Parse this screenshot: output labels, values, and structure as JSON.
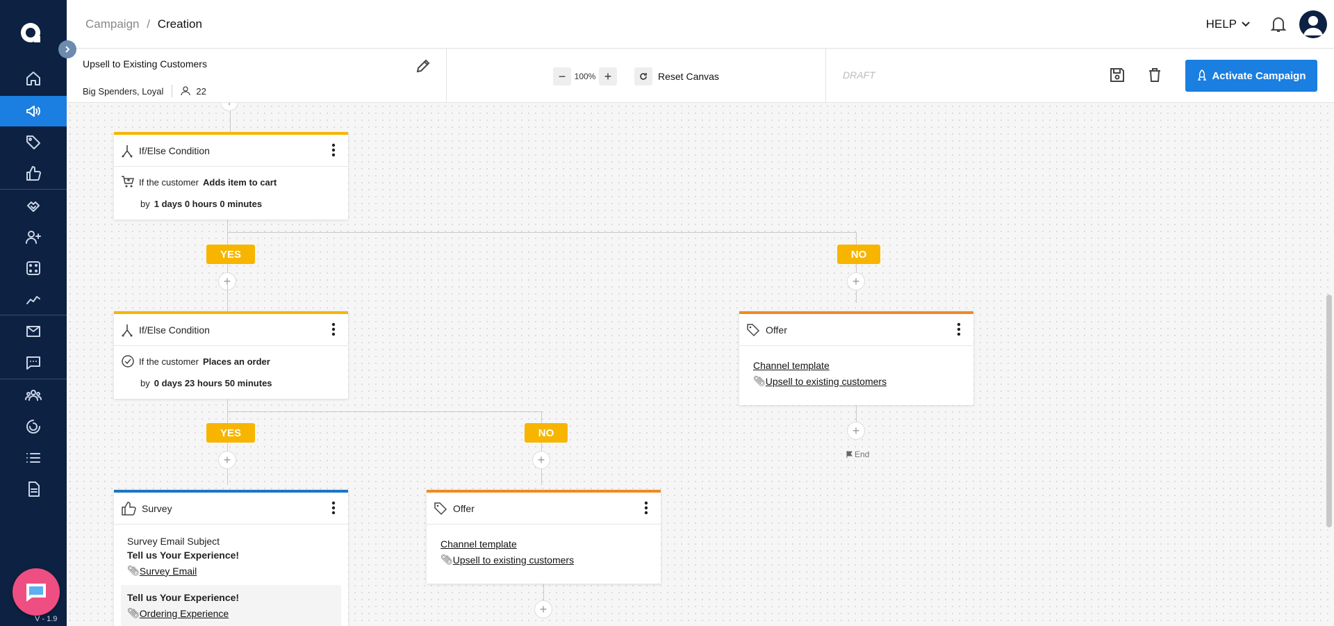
{
  "header": {
    "breadcrumb_parent": "Campaign",
    "breadcrumb_sep": "/",
    "breadcrumb_current": "Creation",
    "help_label": "HELP"
  },
  "campaign": {
    "name": "Upsell to Existing Customers",
    "segments": "Big Spenders, Loyal",
    "audience_count": "22",
    "zoom_minus": "−",
    "zoom_level": "100%",
    "zoom_plus": "+",
    "reset_label": "Reset Canvas",
    "status": "DRAFT",
    "activate_label": "Activate Campaign"
  },
  "sidebar": {
    "version": "V - 1.9",
    "items": [
      "home-icon",
      "campaign-megaphone-icon",
      "tag-icon",
      "thumbs-up-icon",
      "handshake-icon",
      "add-user-icon",
      "dice-icon",
      "analytics-icon",
      "mail-icon",
      "message-icon",
      "users-group-icon",
      "loader-icon",
      "list-icon",
      "document-icon"
    ]
  },
  "canvas": {
    "node1": {
      "title": "If/Else Condition",
      "prefix": "If the customer",
      "event": "Adds item to cart",
      "by": "by",
      "duration": "1 days 0 hours 0 minutes"
    },
    "node2": {
      "title": "If/Else Condition",
      "prefix": "If the customer",
      "event": "Places an order",
      "by": "by",
      "duration": "0 days 23 hours 50 minutes"
    },
    "offer_right": {
      "title": "Offer",
      "channel": "Channel template",
      "attachment": "Upsell to existing customers"
    },
    "offer_mid": {
      "title": "Offer",
      "channel": "Channel template",
      "attachment": "Upsell to existing customers"
    },
    "survey": {
      "title": "Survey",
      "subject_label": "Survey Email Subject",
      "subject": "Tell us Your Experience!",
      "email_link": "Survey Email",
      "question": "Tell us Your Experience!",
      "question_link": "Ordering Experience"
    },
    "yes_label": "YES",
    "no_label": "NO",
    "end_label": "End"
  },
  "colors": {
    "sidebar_bg": "#0d2142",
    "accent": "#1a7fe0",
    "condition": "#f7b500",
    "offer": "#f08a24",
    "survey": "#1a75c5"
  }
}
